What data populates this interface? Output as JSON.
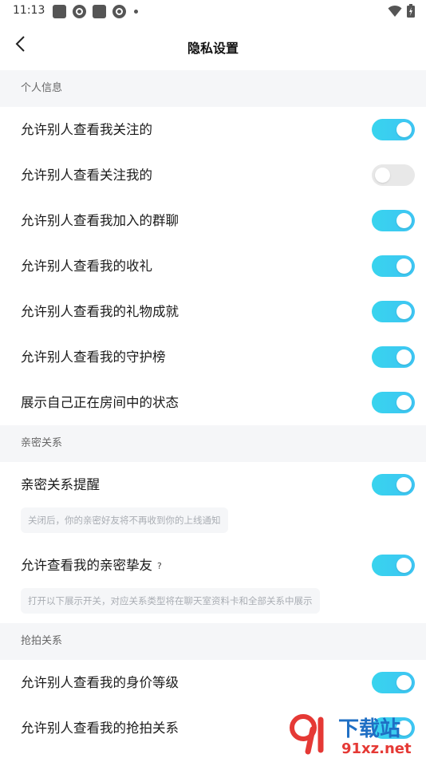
{
  "status_bar": {
    "time": "11:13"
  },
  "nav": {
    "title": "隐私设置"
  },
  "sections": [
    {
      "header": "个人信息",
      "rows": [
        {
          "label": "允许别人查看我关注的",
          "on": true
        },
        {
          "label": "允许别人查看关注我的",
          "on": false
        },
        {
          "label": "允许别人查看我加入的群聊",
          "on": true
        },
        {
          "label": "允许别人查看我的收礼",
          "on": true
        },
        {
          "label": "允许别人查看我的礼物成就",
          "on": true
        },
        {
          "label": "允许别人查看我的守护榜",
          "on": true
        },
        {
          "label": "展示自己正在房间中的状态",
          "on": true
        }
      ]
    },
    {
      "header": "亲密关系",
      "rows": [
        {
          "label": "亲密关系提醒",
          "on": true,
          "hint": "关闭后，你的亲密好友将不再收到你的上线通知"
        },
        {
          "label": "允许查看我的亲密挚友",
          "help": "?",
          "on": true,
          "hint": "打开以下展示开关，对应关系类型将在聊天室资料卡和全部关系中展示"
        }
      ]
    },
    {
      "header": "抢拍关系",
      "rows": [
        {
          "label": "允许别人查看我的身价等级",
          "on": true
        },
        {
          "label": "允许别人查看我的抢拍关系",
          "on": true
        }
      ]
    }
  ],
  "watermark": {
    "main": "下载站",
    "sub": "91xz.net"
  },
  "colors": {
    "toggle_on": "#3ccdf0",
    "toggle_off": "#e8e8e8",
    "section_bg": "#f5f6f8"
  }
}
